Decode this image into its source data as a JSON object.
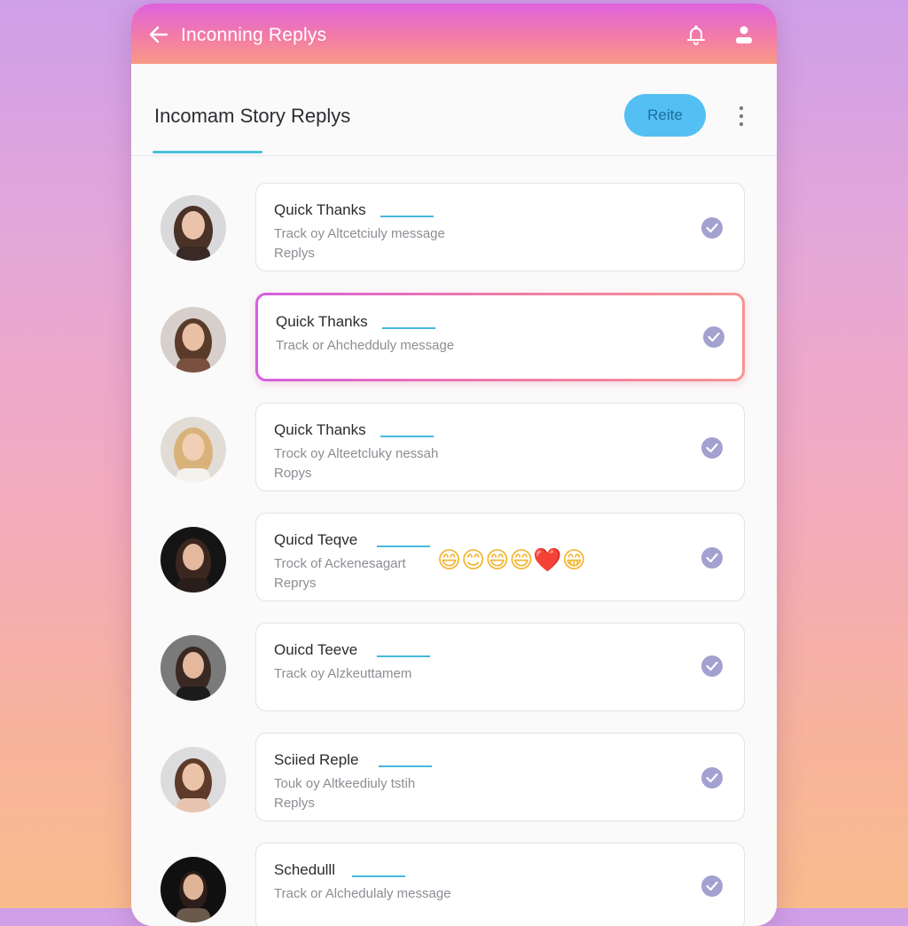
{
  "appbar": {
    "title": "Inconning Replys",
    "icons": [
      "back-arrow-icon",
      "bell-icon",
      "user-icon"
    ]
  },
  "header": {
    "title": "Incomam Story Replys",
    "action_label": "Reite",
    "menu_icon": "more-vertical-icon"
  },
  "colors": {
    "accent_gradient": [
      "#df62dd",
      "#f47ea3",
      "#f89a86"
    ],
    "button": "#54bff3",
    "check": "#a3a1cf",
    "underline": "#4cc0da"
  },
  "replies": [
    {
      "title": "Quick Thanks",
      "line1": "Track oy Altcetciuly message",
      "line2": "Replys",
      "checked": true,
      "selected": false
    },
    {
      "title": "Quick Thanks",
      "line1": "Track or Ahchedduly message",
      "line2": "",
      "checked": true,
      "selected": true
    },
    {
      "title": "Quick Thanks",
      "line1": "Trock oy Alteetcluky nessah",
      "line2": "Ropys",
      "checked": true,
      "selected": false
    },
    {
      "title": "Quicd Teqve",
      "line1": "Trock of Ackenesagart",
      "line2": "Reprys",
      "emojis": "😄😊😄😄❤️😁",
      "checked": true,
      "selected": false
    },
    {
      "title": "Ouicd Teeve",
      "line1": "Track oy Alzkeuttamem",
      "line2": "",
      "checked": true,
      "selected": false
    },
    {
      "title": "Sciied Reple",
      "line1": "Touk oy Altkeediuly tstih",
      "line2": "Replys",
      "checked": true,
      "selected": false
    },
    {
      "title": "Schedulll",
      "line1": "Track or Alchedulaly message",
      "line2": "",
      "checked": true,
      "selected": false
    }
  ]
}
